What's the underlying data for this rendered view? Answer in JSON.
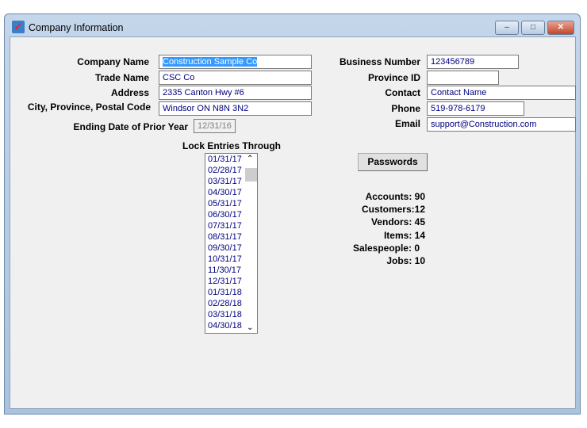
{
  "window": {
    "title": "Company Information",
    "buttons": {
      "minimize": "–",
      "maximize": "□",
      "close": "✕"
    }
  },
  "form": {
    "company_name": {
      "label": "Company Name",
      "value": "Construction Sample Co"
    },
    "trade_name": {
      "label": "Trade Name",
      "value": "CSC Co"
    },
    "address": {
      "label": "Address",
      "value": "2335 Canton Hwy #6"
    },
    "city": {
      "label": "City, Province, Postal Code",
      "value": "Windsor ON  N8N 3N2"
    },
    "ending_date": {
      "label": "Ending Date of Prior Year",
      "value": "12/31/16"
    },
    "business_number": {
      "label": "Business Number",
      "value": "123456789"
    },
    "province_id": {
      "label": "Province ID",
      "value": ""
    },
    "contact": {
      "label": "Contact",
      "value": "Contact Name"
    },
    "phone": {
      "label": "Phone",
      "value": "519-978-6179"
    },
    "email": {
      "label": "Email",
      "value": "support@Construction.com"
    }
  },
  "lock": {
    "label": "Lock Entries Through",
    "items": [
      "01/31/17",
      "02/28/17",
      "03/31/17",
      "04/30/17",
      "05/31/17",
      "06/30/17",
      "07/31/17",
      "08/31/17",
      "09/30/17",
      "10/31/17",
      "11/30/17",
      "12/31/17",
      "01/31/18",
      "02/28/18",
      "03/31/18",
      "04/30/18"
    ]
  },
  "passwords_button": "Passwords",
  "stats": [
    "Accounts: 90",
    "Customers:12",
    "Vendors: 45",
    "Items: 14",
    "Salespeople: 0",
    "Jobs: 10"
  ]
}
